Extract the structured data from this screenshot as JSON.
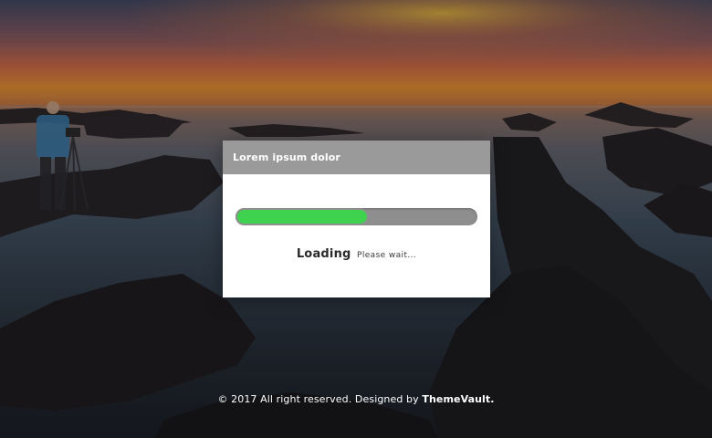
{
  "loader": {
    "title": "Lorem ipsum dolor",
    "progress": 0.55,
    "status_main": "Loading",
    "status_sub": "Please wait..."
  },
  "footer": {
    "copyright": "© 2017 All right reserved. Designed by",
    "brand": "ThemeVault."
  },
  "colors": {
    "header_bg": "#9a9a9a",
    "progress_fill": "#3fd24f",
    "progress_track": "#8e8e8e"
  }
}
